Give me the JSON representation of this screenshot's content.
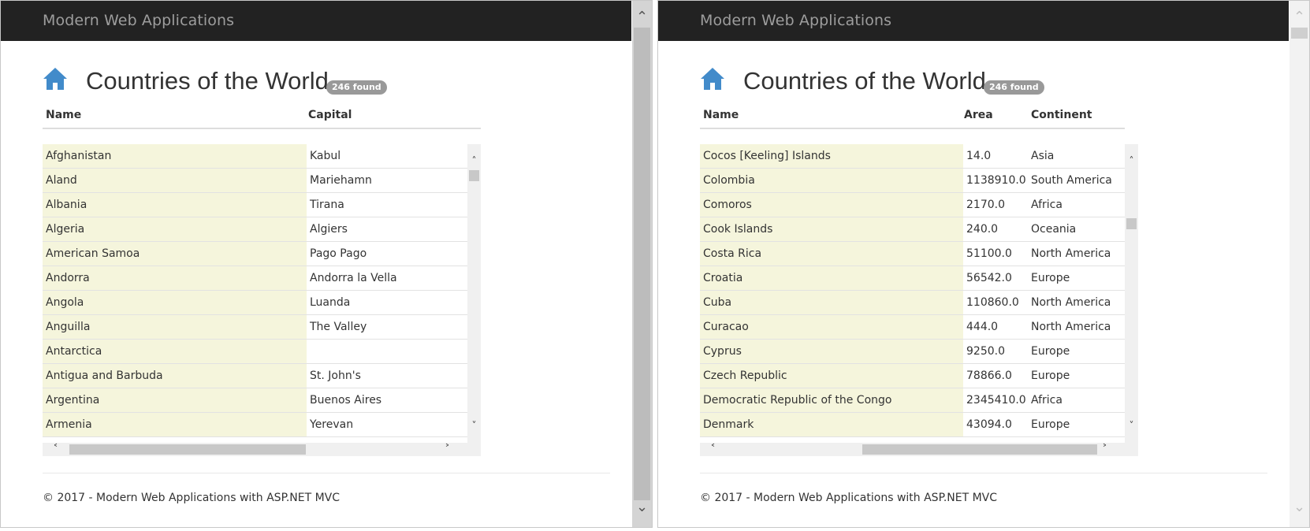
{
  "brand": "Modern Web Applications",
  "title": "Countries of the World",
  "badge": "246 found",
  "footer": "© 2017 - Modern Web Applications with ASP.NET MVC",
  "colors": {
    "navbar": "#222222",
    "first_column": "#f5f5dc",
    "badge": "#999999"
  },
  "left": {
    "columns": [
      "Name",
      "Capital"
    ],
    "rows": [
      [
        "Afghanistan",
        "Kabul"
      ],
      [
        "Aland",
        "Mariehamn"
      ],
      [
        "Albania",
        "Tirana"
      ],
      [
        "Algeria",
        "Algiers"
      ],
      [
        "American Samoa",
        "Pago Pago"
      ],
      [
        "Andorra",
        "Andorra la Vella"
      ],
      [
        "Angola",
        "Luanda"
      ],
      [
        "Anguilla",
        "The Valley"
      ],
      [
        "Antarctica",
        ""
      ],
      [
        "Antigua and Barbuda",
        "St. John's"
      ],
      [
        "Argentina",
        "Buenos Aires"
      ],
      [
        "Armenia",
        "Yerevan"
      ]
    ]
  },
  "right": {
    "columns": [
      "Name",
      "Area",
      "Continent"
    ],
    "rows": [
      [
        "Cocos [Keeling] Islands",
        "14.0",
        "Asia"
      ],
      [
        "Colombia",
        "1138910.0",
        "South America"
      ],
      [
        "Comoros",
        "2170.0",
        "Africa"
      ],
      [
        "Cook Islands",
        "240.0",
        "Oceania"
      ],
      [
        "Costa Rica",
        "51100.0",
        "North America"
      ],
      [
        "Croatia",
        "56542.0",
        "Europe"
      ],
      [
        "Cuba",
        "110860.0",
        "North America"
      ],
      [
        "Curacao",
        "444.0",
        "North America"
      ],
      [
        "Cyprus",
        "9250.0",
        "Europe"
      ],
      [
        "Czech Republic",
        "78866.0",
        "Europe"
      ],
      [
        "Democratic Republic of the Congo",
        "2345410.0",
        "Africa"
      ],
      [
        "Denmark",
        "43094.0",
        "Europe"
      ]
    ]
  }
}
